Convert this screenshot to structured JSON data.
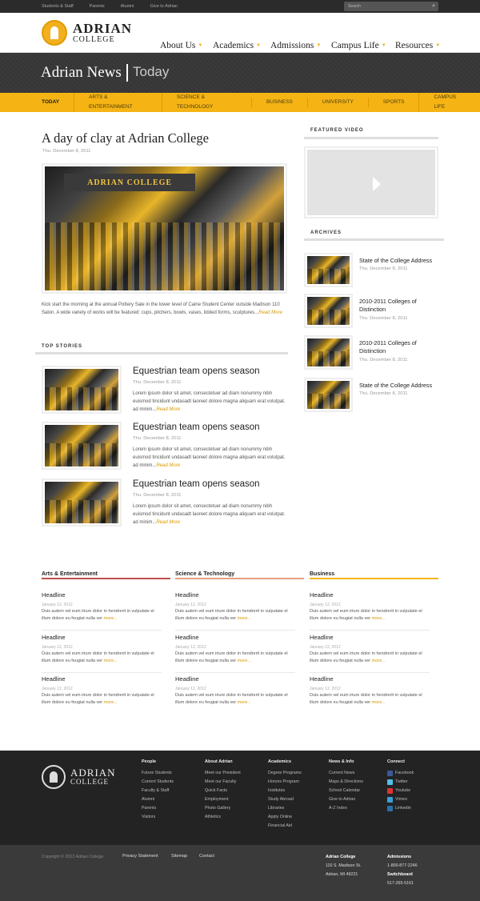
{
  "topbar": {
    "links": [
      "Students & Staff",
      "Parents",
      "Alumni",
      "Give to Adrian"
    ],
    "search_placeholder": "Search"
  },
  "header": {
    "logo_line1": "ADRIAN",
    "logo_line2": "COLLEGE",
    "nav": [
      "About Us",
      "Academics",
      "Admissions",
      "Campus Life",
      "Resources"
    ]
  },
  "banner": {
    "title": "Adrian News",
    "subtitle": "Today"
  },
  "categories": [
    "Today",
    "Arts & Entertainment",
    "Science & Technology",
    "Business",
    "University",
    "Sports",
    "Campus Life"
  ],
  "main": {
    "title": "A day of clay at Adrian College",
    "date": "Thu. December 8, 2011",
    "photo_sign": "ADRIAN COLLEGE",
    "description": "Kick start the morning at the annual Pottery Sale in the lower level of Caine Student Center outside Madison 110 Salon. A wide variety of works will be featured: cups, pitchers, bowls, vases, lidded forms, sculptures...",
    "read_more": "Read More"
  },
  "top_stories": {
    "heading": "TOP STORIES",
    "items": [
      {
        "title": "Equestrian team opens season",
        "date": "Thu. December 8, 2011",
        "text": "Lorem ipsum dolor sit amet, consectetuer ad diam nonummy nibh euismod tincidunt undasadt laoreet dolore magna aliquam erat volutpat.  ad minim...",
        "more": "Read More"
      },
      {
        "title": "Equestrian team opens season",
        "date": "Thu. December 8, 2011",
        "text": "Lorem ipsum dolor sit amet, consectetuer ad diam nonummy nibh euismod tincidunt undasadt laoreet dolore magna aliquam erat volutpat.  ad minim...",
        "more": "Read More"
      },
      {
        "title": "Equestrian team opens season",
        "date": "Thu. December 8, 2011",
        "text": "Lorem ipsum dolor sit amet, consectetuer ad diam nonummy nibh euismod tincidunt undasadt laoreet dolore magna aliquam erat volutpat.  ad minim...",
        "more": "Read More"
      }
    ]
  },
  "sidebar": {
    "video_heading": "FEATURED VIDEO",
    "archives_heading": "ARCHIVES",
    "archives": [
      {
        "title": "State of the College Address",
        "date": "Thu. December 8, 2011"
      },
      {
        "title": "2010-2011 Colleges of Distinction",
        "date": "Thu. December 8, 2011"
      },
      {
        "title": "2010-2011 Colleges of Distinction",
        "date": "Thu. December 8, 2011"
      },
      {
        "title": "State of the College Address",
        "date": "Thu. December 8, 2011"
      }
    ]
  },
  "columns": [
    {
      "heading": "Arts & Entertainment",
      "color": "#c0504d",
      "entries": [
        {
          "headline": "Headline",
          "date": "January 12, 2012",
          "text": "Duis autem vel eum iriure dolor in hendrerit in vulputate el illum dolore eu feugiat nulla ver",
          "more": "more..."
        },
        {
          "headline": "Headline",
          "date": "January 12, 2012",
          "text": "Duis autem vel eum iriure dolor in hendrerit in vulputate el illum dolore eu feugiat nulla ver",
          "more": "more..."
        },
        {
          "headline": "Headline",
          "date": "January 12, 2012",
          "text": "Duis autem vel eum iriure dolor in hendrerit in vulputate el illum dolore eu feugiat nulla ver",
          "more": "more..."
        }
      ]
    },
    {
      "heading": "Science & Technology",
      "color": "#e8a07a",
      "entries": [
        {
          "headline": "Headline",
          "date": "January 12, 2012",
          "text": "Duis autem vel eum iriure dolor in hendrerit in vulputate el illum dolore eu feugiat nulla ver",
          "more": "more..."
        },
        {
          "headline": "Headline",
          "date": "January 12, 2012",
          "text": "Duis autem vel eum iriure dolor in hendrerit in vulputate el illum dolore eu feugiat nulla ver",
          "more": "more..."
        },
        {
          "headline": "Headline",
          "date": "January 12, 2012",
          "text": "Duis autem vel eum iriure dolor in hendrerit in vulputate el illum dolore eu feugiat nulla ver",
          "more": "more..."
        }
      ]
    },
    {
      "heading": "Business",
      "color": "#f5b414",
      "entries": [
        {
          "headline": "Headline",
          "date": "January 12, 2012",
          "text": "Duis autem vel eum iriure dolor in hendrerit in vulputate el illum dolore eu feugiat nulla ver",
          "more": "more..."
        },
        {
          "headline": "Headline",
          "date": "January 12, 2012",
          "text": "Duis autem vel eum iriure dolor in hendrerit in vulputate el illum dolore eu feugiat nulla ver",
          "more": "more..."
        },
        {
          "headline": "Headline",
          "date": "January 12, 2012",
          "text": "Duis autem vel eum iriure dolor in hendrerit in vulputate el illum dolore eu feugiat nulla ver",
          "more": "more..."
        }
      ]
    }
  ],
  "footer": {
    "logo_line1": "ADRIAN",
    "logo_line2": "COLLEGE",
    "columns": [
      {
        "heading": "People",
        "items": [
          "Future Students",
          "Current Students",
          "Faculty & Staff",
          "Alumni",
          "Parents",
          "Visitors"
        ]
      },
      {
        "heading": "About Adrian",
        "items": [
          "Meet our President",
          "Meet our Faculty",
          "Quick Facts",
          "Employment",
          "Photo Gallery",
          "Athletics"
        ]
      },
      {
        "heading": "Academics",
        "items": [
          "Degree Programs",
          "Honors Program",
          "Institutes",
          "Study Abroad",
          "Libraries",
          "Apply Online",
          "Financial Aid"
        ]
      },
      {
        "heading": "News & Info",
        "items": [
          "Current News",
          "Maps & Directions",
          "School Calendar",
          "Give to Adrian",
          "A-Z Index"
        ]
      }
    ],
    "connect": {
      "heading": "Connect",
      "items": [
        {
          "label": "Facebook",
          "icon": "facebook-icon",
          "color": "#3b5998"
        },
        {
          "label": "Twitter",
          "icon": "twitter-icon",
          "color": "#4fc1e9"
        },
        {
          "label": "Youtube",
          "icon": "youtube-icon",
          "color": "#d33"
        },
        {
          "label": "Vimeo",
          "icon": "vimeo-icon",
          "color": "#3aa0d8"
        },
        {
          "label": "Linkedin",
          "icon": "linkedin-icon",
          "color": "#2a6fa8"
        }
      ]
    },
    "bottom": {
      "copyright": "Copyright © 2012 Adrian College",
      "links": [
        "Privacy Statement",
        "Sitemap",
        "Contact"
      ],
      "address_name": "Adrian College",
      "address_line1": "110 S. Madison St.",
      "address_line2": "Adrian, MI 49221",
      "admissions_label": "Admissions",
      "admissions_phone": "1-800-877-2246",
      "switchboard_label": "Switchboard",
      "switchboard_phone": "517-265-5161"
    }
  }
}
